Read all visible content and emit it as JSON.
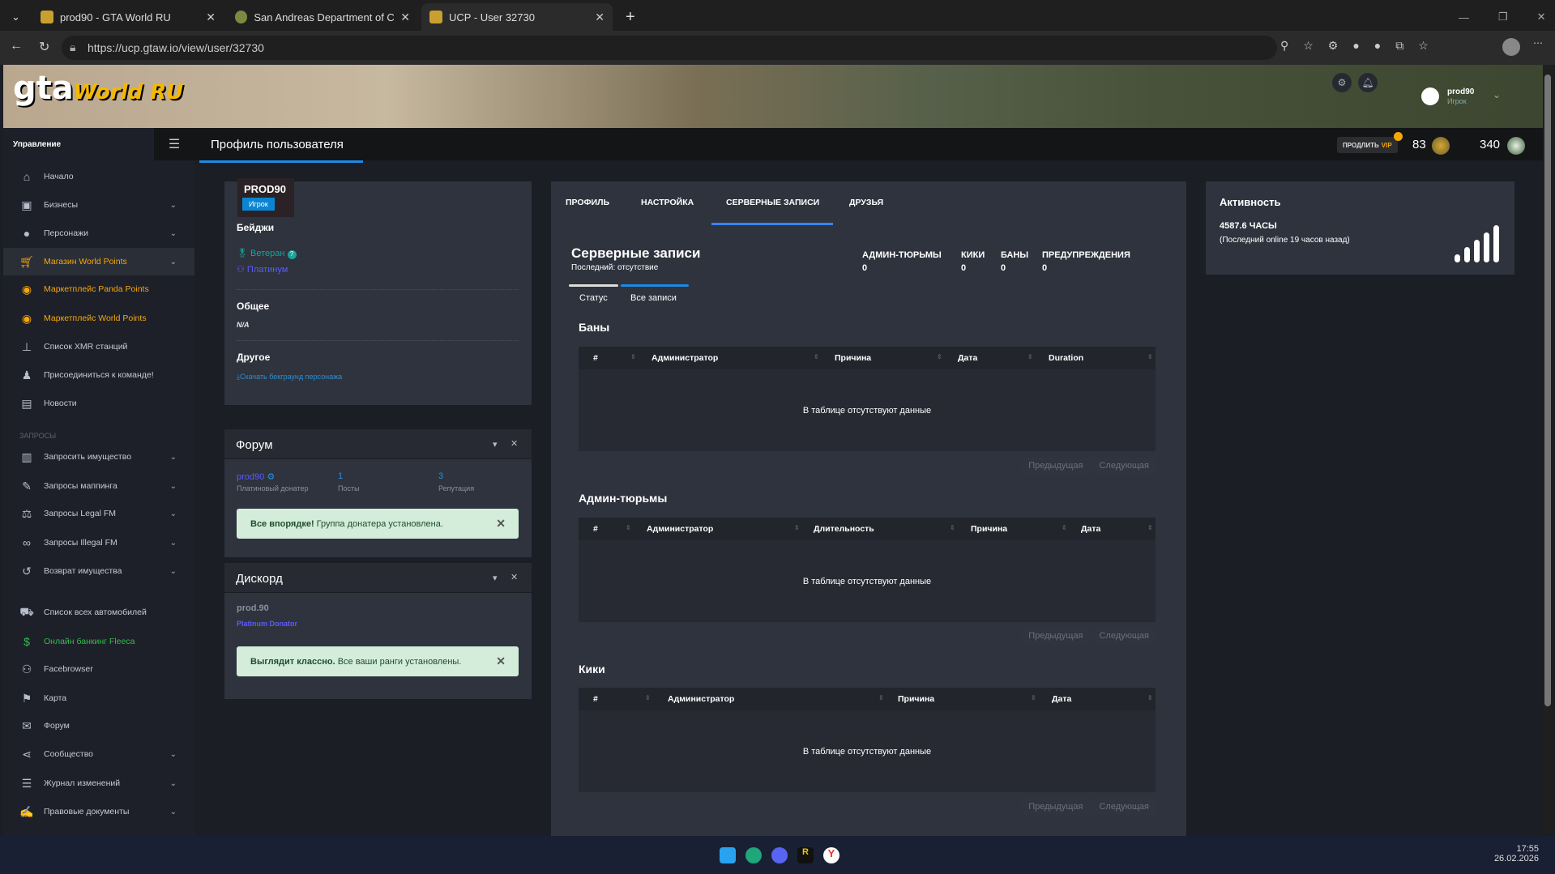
{
  "browser": {
    "tabs": [
      {
        "title": "prod90 - GTA World RU"
      },
      {
        "title": "San Andreas Department of Correc"
      },
      {
        "title": "UCP - User 32730"
      }
    ],
    "url": "https://ucp.gtaw.io/view/user/32730"
  },
  "banner": {
    "logo": "gtaWorld RU",
    "user_name": "prod90",
    "user_role": "Игрок"
  },
  "header": {
    "sidebar_title": "Управление",
    "page_title": "Профиль пользователя",
    "vip_label": "ПРОДЛИТЬ",
    "vip_accent": "VIP",
    "world_points": "83",
    "panda_points": "340"
  },
  "sidebar": {
    "items": [
      {
        "label": "Начало",
        "icon": "home-icon"
      },
      {
        "label": "Бизнесы",
        "icon": "briefcase-icon",
        "chev": true
      },
      {
        "label": "Персонажи",
        "icon": "user-icon",
        "chev": true
      },
      {
        "label": "Магазин World Points",
        "icon": "cart-icon",
        "chev": true,
        "color": "gold",
        "hl": true
      },
      {
        "label": "Маркетплейс Panda Points",
        "icon": "coins-icon",
        "color": "gold"
      },
      {
        "label": "Маркетплейс World Points",
        "icon": "coins-icon",
        "color": "gold"
      },
      {
        "label": "Список XMR станций",
        "icon": "antenna-icon"
      },
      {
        "label": "Присоединиться к команде!",
        "icon": "user-tie-icon"
      },
      {
        "label": "Новости",
        "icon": "newspaper-icon"
      }
    ],
    "section": "ЗАПРОСЫ",
    "items2": [
      {
        "label": "Запросить имущество",
        "icon": "building-icon",
        "chev": true
      },
      {
        "label": "Запросы маппинга",
        "icon": "brush-icon",
        "chev": true
      },
      {
        "label": "Запросы Legal FM",
        "icon": "scale-icon",
        "chev": true
      },
      {
        "label": "Запросы Illegal FM",
        "icon": "mask-icon",
        "chev": true
      },
      {
        "label": "Возврат имущества",
        "icon": "undo-icon",
        "chev": true
      }
    ],
    "items3": [
      {
        "label": "Список всех автомобилей",
        "icon": "car-icon"
      },
      {
        "label": "Онлайн банкинг Fleeca",
        "icon": "money-icon",
        "color": "green"
      },
      {
        "label": "Facebrowser",
        "icon": "users-icon"
      },
      {
        "label": "Карта",
        "icon": "map-icon"
      },
      {
        "label": "Форум",
        "icon": "comments-icon"
      },
      {
        "label": "Сообщество",
        "icon": "share-icon",
        "chev": true
      },
      {
        "label": "Журнал изменений",
        "icon": "list-icon",
        "chev": true
      },
      {
        "label": "Правовые документы",
        "icon": "document-icon",
        "chev": true
      }
    ]
  },
  "profile": {
    "name": "PROD90",
    "role": "Игрок",
    "badges_title": "Бейджи",
    "badges": [
      {
        "label": "Ветеран",
        "color": "#1aa39a"
      },
      {
        "label": "Платинум",
        "color": "#5b5bff"
      }
    ],
    "general_title": "Общее",
    "general_value": "N/A",
    "other_title": "Другое",
    "download_link": "Скачать бекграунд персонажа"
  },
  "forum": {
    "title": "Форум",
    "username": "prod90",
    "group": "Платиновый донатер",
    "posts": "1",
    "posts_label": "Посты",
    "rep": "3",
    "rep_label": "Репутация",
    "alert_bold": "Все впорядке!",
    "alert_text": " Группа донатера установлена."
  },
  "discord": {
    "title": "Дискорд",
    "username": "prod.90",
    "role": "Platinum Donator",
    "alert_bold": "Выглядит классно.",
    "alert_text": " Все ваши ранги установлены."
  },
  "main": {
    "tabs": [
      "ПРОФИЛЬ",
      "НАСТРОЙКА",
      "СЕРВЕРНЫЕ ЗАПИСИ",
      "ДРУЗЬЯ"
    ],
    "active_tab": 2,
    "title": "Серверные записи",
    "subtitle": "Последний: отсутствие",
    "stats": [
      {
        "label": "АДМИН-ТЮРЬМЫ",
        "value": "0"
      },
      {
        "label": "КИКИ",
        "value": "0"
      },
      {
        "label": "БАНЫ",
        "value": "0"
      },
      {
        "label": "ПРЕДУПРЕЖДЕНИЯ",
        "value": "0"
      }
    ],
    "subtabs": [
      "Статус",
      "Все записи"
    ],
    "empty": "В таблице отсутствуют данные",
    "prev": "Предыдущая",
    "next": "Следующая",
    "tables": [
      {
        "title": "Баны",
        "cols": [
          "#",
          "Администратор",
          "Причина",
          "Дата",
          "Duration"
        ]
      },
      {
        "title": "Админ-тюрьмы",
        "cols": [
          "#",
          "Администратор",
          "Длительность",
          "Причина",
          "Дата"
        ]
      },
      {
        "title": "Кики",
        "cols": [
          "#",
          "Администратор",
          "Причина",
          "Дата"
        ]
      }
    ]
  },
  "activity": {
    "title": "Активность",
    "hours": "4587.6 ЧАСЫ",
    "last_online": "(Последний online 19 часов назад)",
    "signal_level": 5
  },
  "taskbar": {
    "time": "17:55",
    "date": "26.02.2026"
  }
}
